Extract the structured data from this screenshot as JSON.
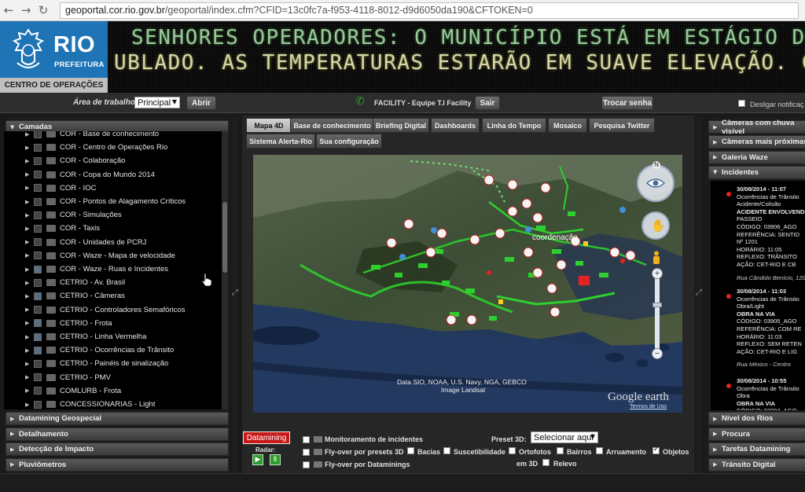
{
  "browser": {
    "back_icon": "back-arrow-icon",
    "forward_icon": "forward-arrow-icon",
    "reload_icon": "reload-icon",
    "url_host": "geoportal.cor.rio.gov.br",
    "url_path": "/geoportal/index.cfm?CFID=13c0fc7a-f953-4118-8012-d9d6050da190&CFTOKEN=0"
  },
  "header": {
    "logo_rio": "RIO",
    "logo_prefeitura": "PREFEITURA",
    "logo_center": "CENTRO DE OPERAÇÕES",
    "ticker_line1": "SENHORES OPERADORES: O MUNICÍPIO ESTÁ EM ESTÁGIO DE VIGI",
    "ticker_line2": "UBLADO. AS TEMPERATURAS ESTARÃO EM SUAVE ELEVAÇÃO. COM N"
  },
  "toolbar": {
    "workspace_label": "Área de trabalho:",
    "workspace_value": "Principal",
    "open_button": "Abrir",
    "facility_text": "FACILITY - Equipe T.I Facility",
    "exit_button": "Sair",
    "change_password_button": "Trocar senha",
    "disable_notifications_label": "Desligar notificaç"
  },
  "left_panel": {
    "layers_header": "Camadas",
    "layers": [
      {
        "label": "COR - Base de conhecimento",
        "checked": false
      },
      {
        "label": "COR - Centro de Operações Rio",
        "checked": false
      },
      {
        "label": "COR - Colaboração",
        "checked": false
      },
      {
        "label": "COR - Copa do Mundo 2014",
        "checked": false
      },
      {
        "label": "COR - IOC",
        "checked": false
      },
      {
        "label": "COR - Pontos de Alagamento Críticos",
        "checked": false
      },
      {
        "label": "COR - Simulações",
        "checked": false
      },
      {
        "label": "COR - Taxis",
        "checked": false
      },
      {
        "label": "COR - Unidades de PCRJ",
        "checked": false
      },
      {
        "label": "COR - Waze - Mapa de velocidade",
        "checked": false
      },
      {
        "label": "COR - Waze - Ruas e Incidentes",
        "checked": true
      },
      {
        "label": "CETRIO - Av. Brasil",
        "checked": false
      },
      {
        "label": "CETRIO - Câmeras",
        "checked": true
      },
      {
        "label": "CETRIO - Controladores Semafóricos",
        "checked": false
      },
      {
        "label": "CETRIO - Frota",
        "checked": true
      },
      {
        "label": "CETRIO - Linha Vermelha",
        "checked": true
      },
      {
        "label": "CETRIO - Ocorrências de Trânsito",
        "checked": true
      },
      {
        "label": "CETRIO - Painéis de sinalização",
        "checked": false
      },
      {
        "label": "CETRIO - PMV",
        "checked": false
      },
      {
        "label": "COMLURB - Frota",
        "checked": false
      },
      {
        "label": "CONCESSIONARIAS - Light",
        "checked": false
      }
    ],
    "sections": [
      "Datamining Geospecial",
      "Detalhamento",
      "Detecção de Impacto",
      "Pluviômetros"
    ]
  },
  "tabs": {
    "row1": [
      "Mapa 4D",
      "Base de conhecimento",
      "Briefing Digital",
      "Dashboards",
      "Linha do Tempo",
      "Mosaico",
      "Pesquisa Twitter"
    ],
    "row2": [
      "Sistema Alerta-Rio",
      "Sua configuração"
    ],
    "active": "Mapa 4D"
  },
  "map": {
    "label_coordenacao": "coordenação",
    "attribution_1": "Data SIO, NOAA, U.S. Navy, NGA, GEBCO",
    "attribution_2": "Image Landsat",
    "brand": "Google earth",
    "terms": "Termos de Uso",
    "compass_north": "N"
  },
  "bottom": {
    "datamining_button": "Datamining",
    "radar_label": "Radar:",
    "play_icon": "play-icon",
    "pause_icon": "pause-icon",
    "monitoring": "Monitoramento de incidentes",
    "flyover_presets": "Fly-over por presets 3D",
    "flyover_datamining": "Fly-over por Dataminings",
    "preset_label": "Preset 3D:",
    "preset_value": "Selecionar aqui",
    "layers": [
      "Bacias",
      "Suscetibilidade",
      "Ortofotos",
      "Bairros",
      "Arruamento",
      "Objetos"
    ],
    "em3d": "em 3D",
    "relevo": "Relevo"
  },
  "right_panel": {
    "sections_top": [
      "Câmeras com chuva visível",
      "Câmeras mais próximas",
      "Galeria Waze",
      "Incidentes"
    ],
    "sections_bottom": [
      "Nível dos Rios",
      "Procura",
      "Tarefas Datamining",
      "Trânsito Digital"
    ],
    "incidents": [
      {
        "date": "30/08/2014 - 11:07",
        "lines": [
          "Ocorrências de Trânsito",
          "Acidente/Colisão"
        ],
        "headline": "ACIDENTE ENVOLVENDO",
        "details": [
          "PASSEIO",
          "CÓDIGO: 03906_AGO",
          "REFERÊNCIA: SENTID",
          "Nº 1201",
          "HORÁRIO: 11:05",
          "REFLEXO: TRÂNSITO",
          "AÇÃO: CET-RIO E CB"
        ],
        "address": "Rua Cândido Benício, 120"
      },
      {
        "date": "30/08/2014 - 11:03",
        "lines": [
          "Ocorrências de Trânsito",
          "Obra/Light"
        ],
        "headline": "OBRA NA VIA",
        "details": [
          "CÓDIGO: 03905_AGO",
          "REFERÊNCIA: COM RE",
          "HORÁRIO: 11:03",
          "REFLEXO: SEM RETEN",
          "AÇÃO: CET-RIO E LIG"
        ],
        "address": "Rua México - Centro"
      },
      {
        "date": "30/08/2014 - 10:55",
        "lines": [
          "Ocorrências de Trânsito",
          "Obra"
        ],
        "headline": "OBRA NA VIA",
        "details": [
          "CÓDIGO: 03904_AGO"
        ],
        "address": ""
      }
    ]
  },
  "colors": {
    "logo_blue": "#1f74b6",
    "ticker_green": "#9bc79a",
    "datamining_red": "#c81818",
    "incident_red": "#e42424",
    "route_green": "#2ecf2e"
  }
}
